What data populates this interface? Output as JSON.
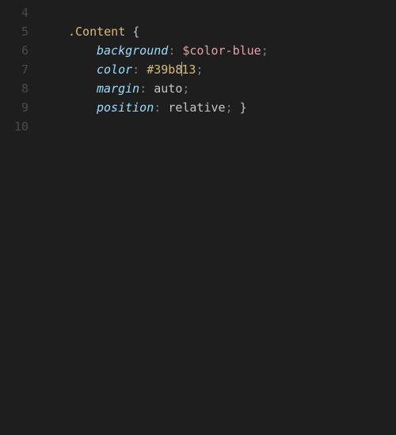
{
  "gutter": {
    "start": 4,
    "end": 10
  },
  "code": {
    "selector": ".Content",
    "open_brace": "{",
    "close_brace": "}",
    "rules": [
      {
        "prop": "background",
        "value": "$color-blue",
        "value_kind": "var"
      },
      {
        "prop": "color",
        "value": "#39b813",
        "value_kind": "hex"
      },
      {
        "prop": "margin",
        "value": "auto",
        "value_kind": "kw"
      },
      {
        "prop": "position",
        "value": "relative",
        "value_kind": "kw"
      }
    ],
    "punct": {
      "colon": ":",
      "semi": ";"
    }
  },
  "cursor": {
    "line_index": 3,
    "after_char": 5
  }
}
